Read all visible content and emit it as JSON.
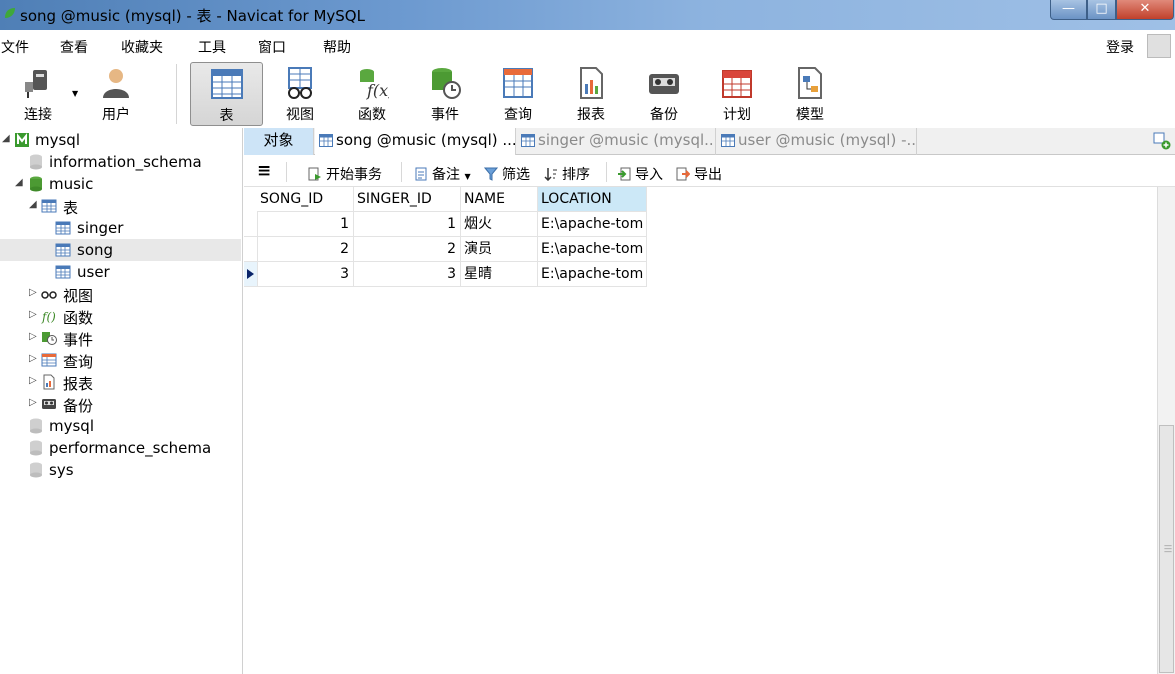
{
  "window": {
    "title": "song @music (mysql) - 表 - Navicat for MySQL",
    "controls": {
      "minimize": "—",
      "maximize": "□",
      "close": "✕"
    }
  },
  "menu": {
    "items": [
      "文件",
      "查看",
      "收藏夹",
      "工具",
      "窗口",
      "帮助"
    ],
    "login": "登录"
  },
  "toolbar": {
    "buttons": [
      {
        "label": "连接",
        "icon": "plug-icon"
      },
      {
        "label": "用户",
        "icon": "user-icon"
      },
      {
        "label": "表",
        "icon": "table-icon",
        "active": true
      },
      {
        "label": "视图",
        "icon": "view-icon"
      },
      {
        "label": "函数",
        "icon": "function-icon"
      },
      {
        "label": "事件",
        "icon": "event-icon"
      },
      {
        "label": "查询",
        "icon": "query-icon"
      },
      {
        "label": "报表",
        "icon": "report-icon"
      },
      {
        "label": "备份",
        "icon": "backup-icon"
      },
      {
        "label": "计划",
        "icon": "schedule-icon"
      },
      {
        "label": "模型",
        "icon": "model-icon"
      }
    ]
  },
  "sidebar": {
    "connection": "mysql",
    "databases": {
      "information_schema": "information_schema",
      "music": "music",
      "tables_group": "表",
      "tables": [
        "singer",
        "song",
        "user"
      ],
      "groups": [
        "视图",
        "函数",
        "事件",
        "查询",
        "报表",
        "备份"
      ],
      "others": [
        "mysql",
        "performance_schema",
        "sys"
      ]
    },
    "selected": "song"
  },
  "tabs": {
    "objects": "对象",
    "open": [
      "song @music (mysql) ...",
      "singer @music (mysql...",
      "user @music (mysql) -..."
    ]
  },
  "data_toolbar": {
    "menu": "≡",
    "begin_transaction": "开始事务",
    "memo": "备注",
    "filter": "筛选",
    "sort": "排序",
    "import": "导入",
    "export": "导出"
  },
  "grid": {
    "columns": [
      "SONG_ID",
      "SINGER_ID",
      "NAME",
      "LOCATION"
    ],
    "active_column": "LOCATION",
    "rows": [
      [
        "1",
        "1",
        "烟火",
        "E:\\apache-tom"
      ],
      [
        "2",
        "2",
        "演员",
        "E:\\apache-tom"
      ],
      [
        "3",
        "3",
        "星晴",
        "E:\\apache-tom"
      ]
    ],
    "current_row": 3
  },
  "colors": {
    "titlebar": "#6d9ad0",
    "selected_tab": "#cde4f7",
    "active_header": "#cce8f7",
    "row_marker": "#0a246a"
  }
}
